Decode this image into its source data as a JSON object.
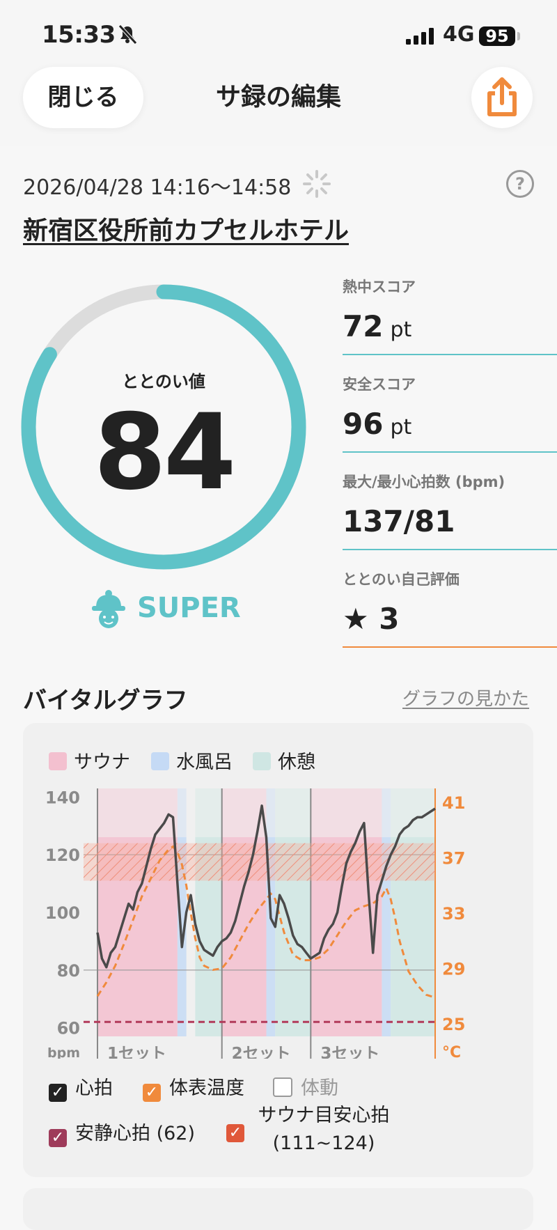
{
  "status_bar": {
    "time": "15:33",
    "network": "4G",
    "battery": "95"
  },
  "header": {
    "close_label": "閉じる",
    "title": "サ録の編集"
  },
  "session": {
    "datetime": "2026/04/28 14:16〜14:58",
    "facility": "新宿区役所前カプセルホテル"
  },
  "totonoi": {
    "label": "ととのい値",
    "value": "84",
    "fraction": 0.84,
    "rank": "SUPER"
  },
  "stats": [
    {
      "label": "熱中スコア",
      "value": "72",
      "unit": "pt",
      "color": "#5fc3c8"
    },
    {
      "label": "安全スコア",
      "value": "96",
      "unit": "pt",
      "color": "#5fc3c8"
    },
    {
      "label": "最大/最小心拍数 (bpm)",
      "value": "137/81",
      "unit": "",
      "color": "#5fc3c8"
    },
    {
      "label": "ととのい自己評価",
      "value": "★ 3",
      "unit": "",
      "color": "#f08a3c"
    }
  ],
  "vitals": {
    "title": "バイタルグラフ",
    "guide_link": "グラフの見かた",
    "legend": [
      {
        "label": "サウナ",
        "color": "#f3c0cf"
      },
      {
        "label": "水風呂",
        "color": "#c5daf5"
      },
      {
        "label": "休憩",
        "color": "#cfe6e3"
      }
    ],
    "options": [
      {
        "label": "心拍",
        "checked": true,
        "color": "#222222"
      },
      {
        "label": "体表温度",
        "checked": true,
        "color": "#f08a3c"
      },
      {
        "label": "体動",
        "checked": false,
        "color": "#999999"
      },
      {
        "label": "安静心拍 (62)",
        "checked": true,
        "color": "#9e3b5a"
      },
      {
        "label_line1": "サウナ目安心拍",
        "label_line2": "(111~124)",
        "checked": true,
        "color": "#e0583a"
      }
    ]
  },
  "chart_data": {
    "type": "line",
    "ylabel": "bpm",
    "y2label": "°C",
    "ylim": [
      57,
      143
    ],
    "y2lim": [
      24.1,
      42.0
    ],
    "yticks": [
      "140",
      "120",
      "100",
      "80",
      "60"
    ],
    "y2ticks": [
      "41",
      "37",
      "33",
      "29",
      "25"
    ],
    "sets": [
      "1セット",
      "2セット",
      "3セット"
    ],
    "phases": [
      {
        "type": "sauna",
        "start": 0,
        "end": 9
      },
      {
        "type": "cold",
        "start": 9,
        "end": 10
      },
      {
        "type": "rest",
        "start": 11,
        "end": 14
      },
      {
        "type": "sauna",
        "start": 14,
        "end": 19
      },
      {
        "type": "cold",
        "start": 19,
        "end": 20
      },
      {
        "type": "rest",
        "start": 20,
        "end": 24
      },
      {
        "type": "sauna",
        "start": 24,
        "end": 32
      },
      {
        "type": "cold",
        "start": 32,
        "end": 33
      },
      {
        "type": "rest",
        "start": 33,
        "end": 38
      }
    ],
    "set_boundaries": [
      0,
      14,
      24
    ],
    "resting_hr": 62,
    "target_hr": [
      111,
      124
    ],
    "series": [
      {
        "name": "心拍",
        "color": "#4a4a4a",
        "x": [
          0,
          0.5,
          1,
          1.5,
          2,
          2.5,
          3,
          3.5,
          4,
          4.5,
          5,
          5.5,
          6,
          6.5,
          7,
          7.5,
          8,
          8.5,
          9,
          9.5,
          10,
          10.5,
          11,
          11.5,
          12,
          12.5,
          13,
          13.5,
          14,
          14.5,
          15,
          15.5,
          16,
          16.5,
          17,
          17.5,
          18,
          18.5,
          19,
          19.5,
          20,
          20.5,
          21,
          21.5,
          22,
          22.5,
          23,
          23.5,
          24,
          24.5,
          25,
          25.5,
          26,
          26.5,
          27,
          27.5,
          28,
          28.5,
          29,
          29.5,
          30,
          30.5,
          31,
          31.5,
          32,
          32.5,
          33,
          33.5,
          34,
          34.5,
          35,
          35.5,
          36,
          36.5,
          37,
          37.5,
          38
        ],
        "values": [
          93,
          84,
          81,
          86,
          88,
          93,
          98,
          103,
          101,
          107,
          110,
          116,
          122,
          127,
          129,
          131,
          134,
          133,
          110,
          88,
          100,
          106,
          96,
          90,
          87,
          86,
          85,
          88,
          90,
          91,
          93,
          97,
          103,
          109,
          114,
          120,
          128,
          137,
          126,
          98,
          95,
          106,
          103,
          98,
          92,
          89,
          88,
          86,
          84,
          85,
          86,
          91,
          94,
          96,
          100,
          109,
          117,
          121,
          124,
          128,
          131,
          107,
          86,
          106,
          111,
          116,
          120,
          123,
          127,
          129,
          130,
          132,
          133,
          133,
          134,
          135,
          136
        ]
      },
      {
        "name": "体表温度",
        "color": "#f08a3c",
        "x": [
          0,
          1,
          2,
          3,
          4,
          5,
          6,
          7,
          8,
          8.5,
          9,
          9.5,
          10,
          10.5,
          11,
          11.5,
          12,
          13,
          14,
          15,
          16,
          17,
          18,
          19,
          19.5,
          20,
          21,
          22,
          23,
          24,
          25,
          26,
          27,
          28,
          29,
          30,
          31,
          32,
          32.5,
          33,
          33.5,
          34,
          35,
          36,
          37,
          38
        ],
        "values": [
          27.0,
          28.0,
          29.2,
          30.8,
          32.5,
          34.2,
          35.5,
          36.8,
          37.6,
          37.8,
          37.4,
          36.5,
          35.0,
          33.0,
          31.2,
          29.8,
          29.2,
          28.9,
          29.0,
          29.8,
          31.0,
          32.2,
          33.2,
          34.0,
          34.4,
          34.0,
          31.6,
          30.0,
          29.6,
          29.6,
          29.8,
          30.4,
          31.4,
          32.4,
          33.2,
          33.5,
          33.7,
          34.2,
          34.8,
          34.0,
          32.6,
          31.0,
          28.8,
          27.8,
          27.1,
          26.9
        ]
      }
    ]
  }
}
